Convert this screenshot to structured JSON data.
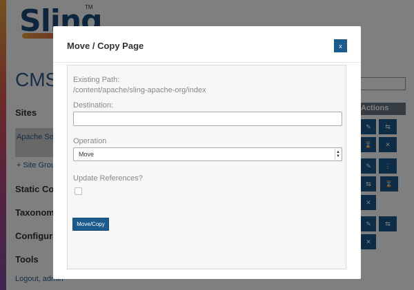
{
  "background": {
    "logo_text": "Sling",
    "logo_tm": "TM",
    "cms_title": "CMS",
    "nav": {
      "sites_heading": "Sites",
      "site_item": "Apache Sof Foundation",
      "site_group_link": "+ Site Grou",
      "static_heading": "Static Co",
      "taxonomy_heading": "Taxonom",
      "config_heading": "Configura",
      "tools_heading": "Tools",
      "logout_link": "Logout, admin"
    },
    "actions_heading": "Actions",
    "action_icons": [
      "pencil-icon",
      "move-icon",
      "versions-icon",
      "delete-icon"
    ]
  },
  "modal": {
    "title": "Move / Copy Page",
    "close_label": "x",
    "existing_path_label": "Existing Path:",
    "existing_path_value": "/content/apache/sling-apache-org/index",
    "destination_label": "Destination:",
    "destination_value": "",
    "operation_label": "Operation",
    "operation_selected": "Move",
    "update_references_label": "Update References?",
    "update_references_checked": false,
    "submit_label": "Move/Copy"
  },
  "colors": {
    "primary_button": "#1a5a8c",
    "overlay": "rgba(0,0,0,0.5)",
    "heading_blue": "#2e5d88"
  }
}
